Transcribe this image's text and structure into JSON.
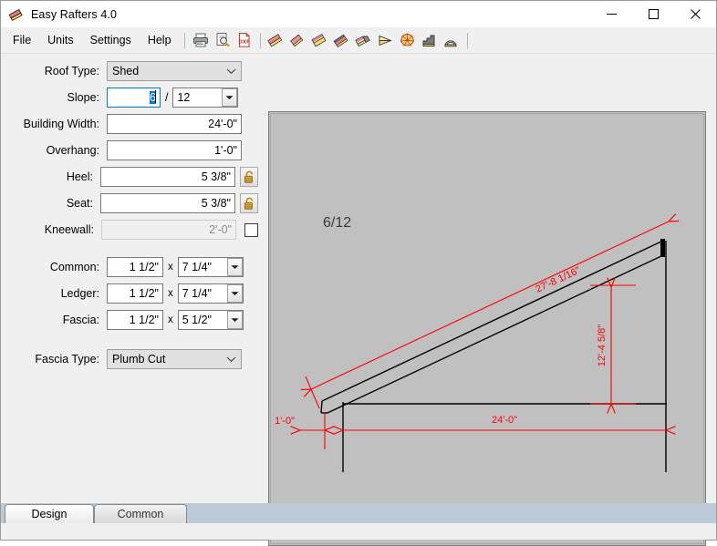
{
  "window": {
    "title": "Easy Rafters 4.0",
    "app_icon": "rafter-icon",
    "minimize_label": "Minimize",
    "maximize_label": "Maximize",
    "close_label": "Close"
  },
  "menu": {
    "items": [
      {
        "label": "File",
        "name": "menu-file"
      },
      {
        "label": "Units",
        "name": "menu-units"
      },
      {
        "label": "Settings",
        "name": "menu-settings"
      },
      {
        "label": "Help",
        "name": "menu-help"
      }
    ]
  },
  "toolbar": {
    "buttons": [
      {
        "icon": "print-icon",
        "title": "Print"
      },
      {
        "icon": "print-preview-icon",
        "title": "Print Preview"
      },
      {
        "icon": "dxf-export-icon",
        "title": "Export DXF"
      },
      {
        "icon": "common-rafter-icon",
        "title": "Common Rafter"
      },
      {
        "icon": "hip-rafter-icon",
        "title": "Hip Rafter"
      },
      {
        "icon": "valley-rafter-icon",
        "title": "Valley Rafter"
      },
      {
        "icon": "jack-rafter-icon",
        "title": "Jack Rafter"
      },
      {
        "icon": "ridge-board-icon",
        "title": "Ridge Board"
      },
      {
        "icon": "angle-cut-icon",
        "title": "Angle Cut"
      },
      {
        "icon": "polygon-roof-icon",
        "title": "Polygon Roof"
      },
      {
        "icon": "stair-icon",
        "title": "Stairs"
      },
      {
        "icon": "arch-icon",
        "title": "Arch"
      }
    ]
  },
  "form": {
    "roof_type": {
      "label": "Roof Type:",
      "value": "Shed"
    },
    "slope": {
      "label": "Slope:",
      "rise": "6",
      "run": "12"
    },
    "building_width": {
      "label": "Building Width:",
      "value": "24'-0\""
    },
    "overhang": {
      "label": "Overhang:",
      "value": "1'-0\""
    },
    "heel": {
      "label": "Heel:",
      "value": "5 3/8\"",
      "lock_icon": "padlock-open-icon"
    },
    "seat": {
      "label": "Seat:",
      "value": "5 3/8\"",
      "lock_icon": "padlock-open-icon"
    },
    "kneewall": {
      "label": "Kneewall:",
      "value": "2'-0\"",
      "enabled": false,
      "checked": false
    },
    "common": {
      "label": "Common:",
      "thickness": "1 1/2\"",
      "separator": "x",
      "depth": "7 1/4\""
    },
    "ledger": {
      "label": "Ledger:",
      "thickness": "1 1/2\"",
      "separator": "x",
      "depth": "7 1/4\""
    },
    "fascia": {
      "label": "Fascia:",
      "thickness": "1 1/2\"",
      "separator": "x",
      "depth": "5 1/2\""
    },
    "fascia_type": {
      "label": "Fascia Type:",
      "value": "Plumb Cut"
    }
  },
  "drawing": {
    "background_color": "#c0c0c0",
    "dimension_color": "#ff0000",
    "structure_color": "#000000",
    "slope_label": "6/12",
    "rafter_length": "27'-8 1/16\"",
    "wall_height": "12'-4 5/8\"",
    "overhang_dim": "1'-0\"",
    "width_dim": "24'-0\""
  },
  "tabs": [
    {
      "label": "Design",
      "active": true
    },
    {
      "label": "Common",
      "active": false
    }
  ]
}
